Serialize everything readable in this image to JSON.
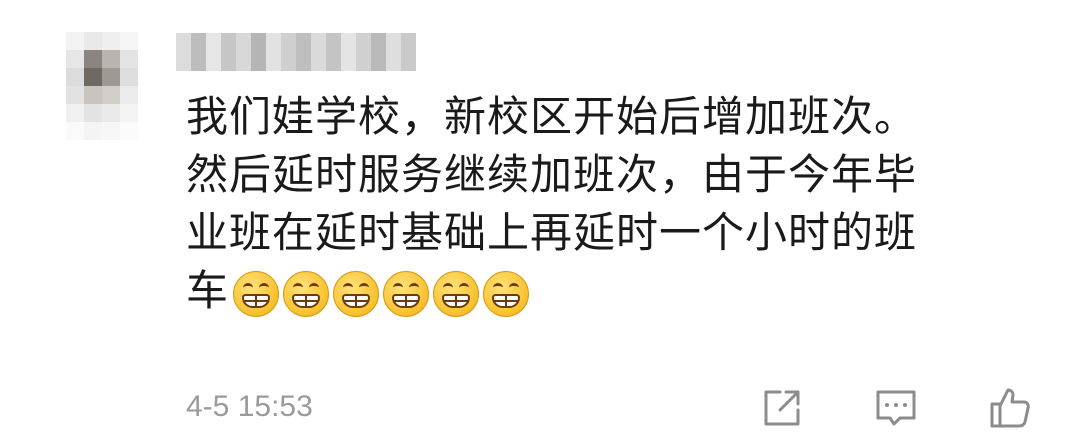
{
  "comment": {
    "body_lines": [
      "我们娃学校，新校区开始后增加班次。",
      "然后延时服务继续加班次，由于今年毕",
      "业班在延时基础上再延时一个小时的班",
      "车"
    ],
    "emoji_icons": [
      "grinning-face-icon",
      "grinning-face-icon",
      "grinning-face-icon",
      "grinning-face-icon",
      "grinning-face-icon",
      "grinning-face-icon"
    ],
    "timestamp": "4-5 15:53"
  },
  "actions": {
    "share_icon": "share-icon",
    "reply_icon": "comment-icon",
    "like_icon": "thumbs-up-icon"
  },
  "colors": {
    "text": "#1a1a1a",
    "meta": "#9a9a9a",
    "icon": "#8c8c8c"
  }
}
